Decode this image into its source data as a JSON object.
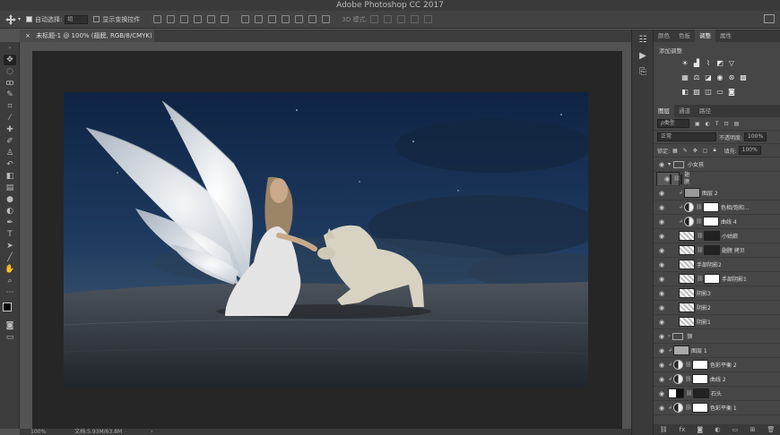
{
  "app": {
    "title": "Adobe Photoshop CC 2017"
  },
  "options_bar": {
    "auto_select_label": "自动选择:",
    "auto_select_value": "组",
    "show_transform_label": "显示变换控件",
    "mode_3d_label": "3D 模式:"
  },
  "document": {
    "tab_title": "未标题-1 @ 100% (翅膀, RGB/8/CMYK) *"
  },
  "status": {
    "zoom": "100%",
    "doc_size": "文档:5.93M/63.8M"
  },
  "panels": {
    "top_tabs": [
      "颜色",
      "色板",
      "调整",
      "属性"
    ],
    "active_top_tab": 2,
    "adjust_title": "添加调整",
    "layers_tabs": [
      "图层",
      "通道",
      "路径"
    ],
    "filter_label": "ρ类型",
    "blend_mode": "正常",
    "opacity_label": "不透明度:",
    "opacity_value": "100%",
    "lock_label": "锁定:",
    "fill_label": "填充:",
    "fill_value": "100%",
    "layers": [
      {
        "name": "小女孩",
        "kind": "group"
      },
      {
        "name": "翅膀",
        "kind": "pixel-mask",
        "selected": true
      },
      {
        "name": "图层 2",
        "kind": "clip-gray"
      },
      {
        "name": "色相/饱和...",
        "kind": "adjust-clip"
      },
      {
        "name": "曲线 4",
        "kind": "adjust-clip"
      },
      {
        "name": "小姑娘",
        "kind": "pixel-mask-dark"
      },
      {
        "name": "翅膀 拷贝",
        "kind": "pixel-mask-dark"
      },
      {
        "name": "手部阴影2",
        "kind": "checker"
      },
      {
        "name": "手部阴影1",
        "kind": "checker-mask"
      },
      {
        "name": "阴影3",
        "kind": "checker"
      },
      {
        "name": "阴影2",
        "kind": "checker"
      },
      {
        "name": "阴影1",
        "kind": "checker"
      },
      {
        "name": "狼",
        "kind": "group-closed"
      },
      {
        "name": "图层 1",
        "kind": "clip-gray"
      },
      {
        "name": "色彩平衡 2",
        "kind": "adjust-clip"
      },
      {
        "name": "曲线 2",
        "kind": "adjust-clip"
      },
      {
        "name": "石头",
        "kind": "pixel-mask-mix"
      },
      {
        "name": "色彩平衡 1",
        "kind": "adjust-clip"
      }
    ]
  }
}
